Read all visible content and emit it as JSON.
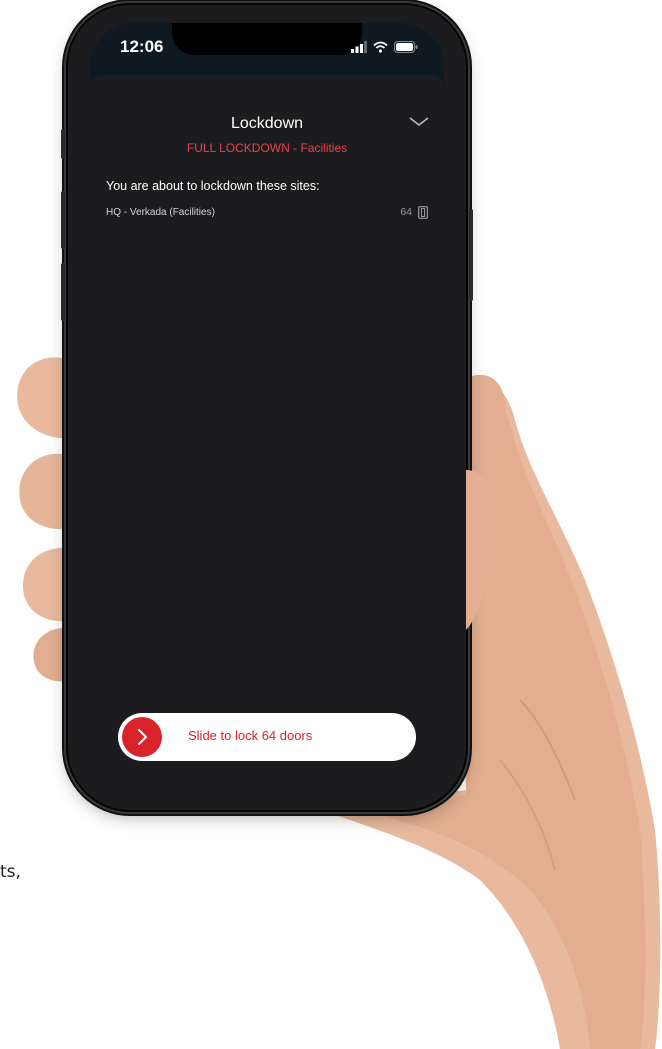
{
  "status_bar": {
    "time": "12:06"
  },
  "sheet": {
    "title": "Lockdown",
    "subtitle": "FULL LOCKDOWN - Facilities",
    "section_heading": "You are about to lockdown these sites:",
    "sites": [
      {
        "name": "HQ - Verkada (Facilities)",
        "doors": "64"
      }
    ]
  },
  "slider": {
    "label": "Slide to lock 64 doors"
  },
  "background_text": "ts,",
  "colors": {
    "accent_red": "#d8232a",
    "subtitle_red": "#e5434a",
    "sheet_bg": "#1c1c1e"
  },
  "icons": [
    "chevron-down-icon",
    "door-icon",
    "signal-icon",
    "wifi-icon",
    "battery-icon",
    "chevron-right-icon"
  ]
}
